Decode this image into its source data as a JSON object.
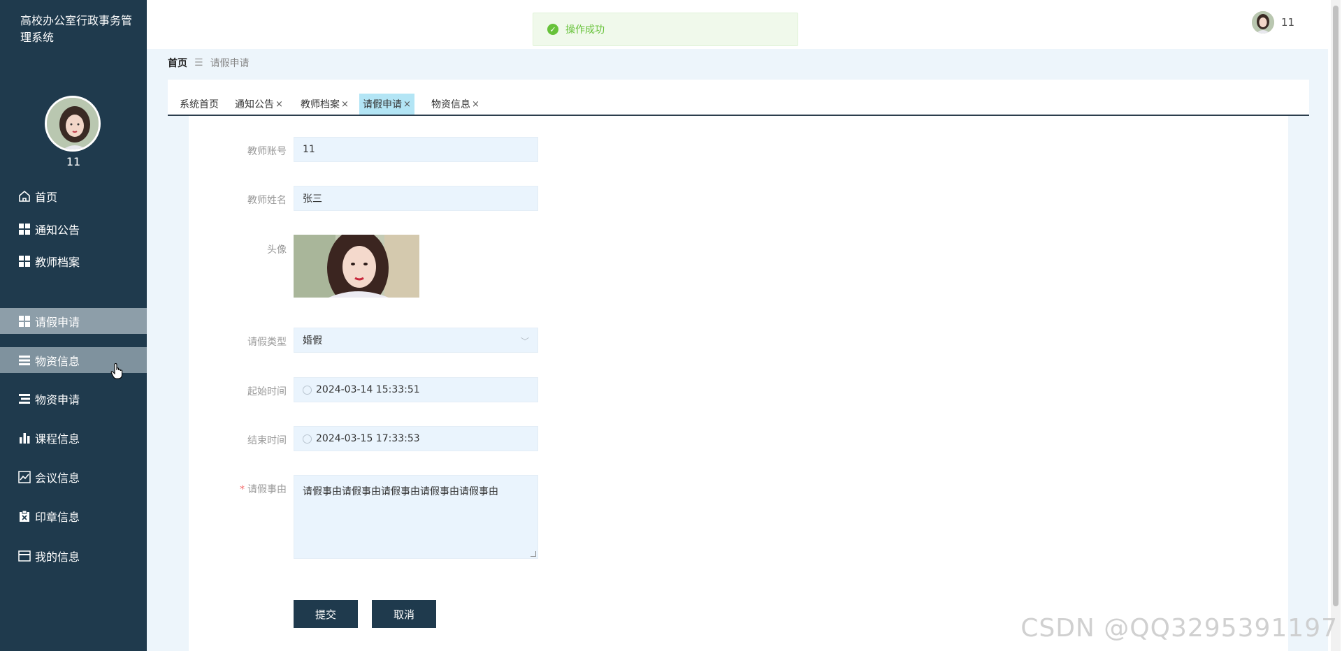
{
  "app": {
    "title": "高校办公室行政事务管理系统"
  },
  "user": {
    "name": "11"
  },
  "sidebar": {
    "items": [
      {
        "label": "首页",
        "icon": "home-icon"
      },
      {
        "label": "通知公告",
        "icon": "grid-icon"
      },
      {
        "label": "教师档案",
        "icon": "grid-icon"
      },
      {
        "label": "请假申请",
        "icon": "grid-icon",
        "active": true
      },
      {
        "label": "物资信息",
        "icon": "list-icon",
        "hover": true
      },
      {
        "label": "物资申请",
        "icon": "list-icon"
      },
      {
        "label": "课程信息",
        "icon": "bar-chart-icon"
      },
      {
        "label": "会议信息",
        "icon": "line-chart-icon"
      },
      {
        "label": "印章信息",
        "icon": "clipboard-icon"
      },
      {
        "label": "我的信息",
        "icon": "card-icon"
      }
    ]
  },
  "toast": {
    "message": "操作成功"
  },
  "breadcrumb": {
    "home": "首页",
    "sep": "☰",
    "current": "请假申请"
  },
  "tabs": [
    {
      "label": "系统首页",
      "closable": false
    },
    {
      "label": "通知公告",
      "closable": true
    },
    {
      "label": "教师档案",
      "closable": true
    },
    {
      "label": "请假申请",
      "closable": true,
      "active": true
    },
    {
      "label": "物资信息",
      "closable": true
    }
  ],
  "tab_close": "×",
  "form": {
    "account_label": "教师账号",
    "account_value": "11",
    "name_label": "教师姓名",
    "name_value": "张三",
    "photo_label": "头像",
    "type_label": "请假类型",
    "type_value": "婚假",
    "start_label": "起始时间",
    "start_value": "2024-03-14 15:33:51",
    "end_label": "结束时间",
    "end_value": "2024-03-15 17:33:53",
    "reason_label": "请假事由",
    "reason_required": "*",
    "reason_value": "请假事由请假事由请假事由请假事由请假事由",
    "submit": "提交",
    "cancel": "取消"
  },
  "watermark": "CSDN @QQ3295391197",
  "colors": {
    "sidebar": "#1f3a4d",
    "active_tab": "#b3e5f5",
    "toast": "#67c23a"
  }
}
